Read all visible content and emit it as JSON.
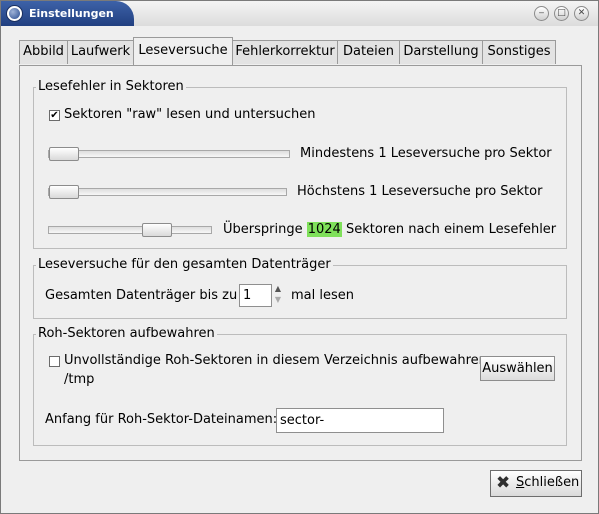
{
  "window": {
    "title": "Einstellungen",
    "controls": [
      "minimize",
      "maximize",
      "close"
    ]
  },
  "tabs": [
    {
      "label": "Abbild",
      "active": false
    },
    {
      "label": "Laufwerk",
      "active": false
    },
    {
      "label": "Leseversuche",
      "active": true
    },
    {
      "label": "Fehlerkorrektur",
      "active": false
    },
    {
      "label": "Dateien",
      "active": false
    },
    {
      "label": "Darstellung",
      "active": false
    },
    {
      "label": "Sonstiges",
      "active": false
    }
  ],
  "section_lesefehler": {
    "title": "Lesefehler in Sektoren",
    "checkbox_raw": {
      "label": "Sektoren \"raw\" lesen und untersuchen",
      "checked": true
    },
    "slider_min": {
      "label": "Mindestens 1 Leseversuche pro Sektor",
      "value_fraction": 0.0
    },
    "slider_max": {
      "label": "Höchstens 1 Leseversuche pro Sektor",
      "value_fraction": 0.0
    },
    "slider_skip": {
      "label_prefix": "Überspringe",
      "value": "1024",
      "label_suffix": "Sektoren nach einem Lesefehler",
      "value_fraction": 0.57
    }
  },
  "section_gesamt": {
    "title": "Leseversuche für den gesamten Datenträger",
    "label_prefix": "Gesamten Datenträger bis zu",
    "spin_value": "1",
    "label_suffix": "mal lesen"
  },
  "section_roh": {
    "title": "Roh-Sektoren aufbewahren",
    "checkbox_keep": {
      "label": "Unvollständige Roh-Sektoren in diesem Verzeichnis aufbewahren:",
      "checked": false
    },
    "directory": "/tmp",
    "choose_button": "Auswählen",
    "prefix_label": "Anfang für Roh-Sektor-Dateinamen:",
    "prefix_value": "sector-"
  },
  "footer": {
    "close_button": "Schließen",
    "close_mnemonic": "S",
    "close_rest": "chließen"
  }
}
